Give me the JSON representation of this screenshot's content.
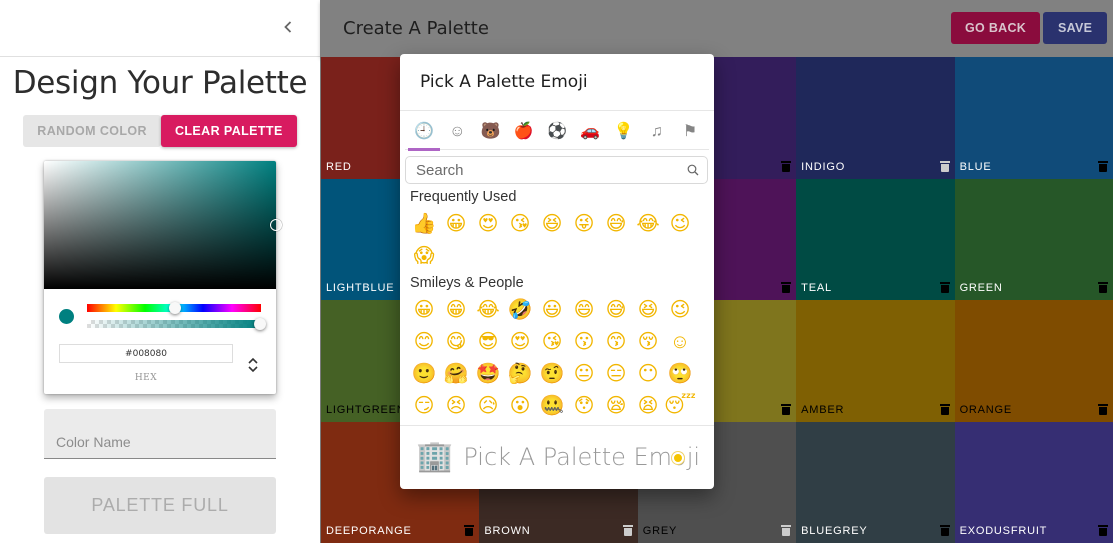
{
  "sidebar": {
    "title": "Design Your Palette",
    "random_color_label": "Random Color",
    "clear_palette_label": "Clear Palette",
    "picker": {
      "hex_value": "#008080",
      "mode_label": "HEX"
    },
    "color_name_placeholder": "Color Name",
    "palette_full_label": "Palette Full"
  },
  "appbar": {
    "title": "Create A Palette",
    "go_back_label": "GO BACK",
    "save_label": "SAVE"
  },
  "palette": [
    {
      "name": "red",
      "color": "#F44336",
      "trash": true
    },
    {
      "name": "",
      "color": "#E91E63",
      "trash": true
    },
    {
      "name": "",
      "color": "#673AB7",
      "trash": true
    },
    {
      "name": "indigo",
      "color": "#3F51B5",
      "trash": true
    },
    {
      "name": "blue",
      "color": "#2196F3",
      "trash": true
    },
    {
      "name": "lightblue",
      "color": "#03A9F4",
      "trash": true
    },
    {
      "name": "",
      "color": "#00BCD4",
      "trash": true
    },
    {
      "name": "",
      "color": "#9C27B0",
      "trash": true
    },
    {
      "name": "teal",
      "color": "#009688",
      "trash": true
    },
    {
      "name": "green",
      "color": "#4CAF50",
      "trash": true
    },
    {
      "name": "lightgreen",
      "color": "#8BC34A",
      "trash": true
    },
    {
      "name": "",
      "color": "#CDDC39",
      "trash": true
    },
    {
      "name": "",
      "color": "#FFEB3B",
      "trash": true
    },
    {
      "name": "amber",
      "color": "#FFC107",
      "trash": true
    },
    {
      "name": "orange",
      "color": "#FF9800",
      "trash": true
    },
    {
      "name": "deeporange",
      "color": "#FF5722",
      "trash": true
    },
    {
      "name": "brown",
      "color": "#795548",
      "trash": true
    },
    {
      "name": "grey",
      "color": "#9E9E9E",
      "trash": true
    },
    {
      "name": "bluegrey",
      "color": "#607D8B",
      "trash": true
    },
    {
      "name": "exodusfruit",
      "color": "#6C5CE7",
      "trash": true
    }
  ],
  "emoji_picker": {
    "title": "Pick A Palette Emoji",
    "categories": [
      {
        "icon": "clock-icon",
        "glyph": "🕘"
      },
      {
        "icon": "smiley-icon",
        "glyph": "☺"
      },
      {
        "icon": "animal-icon",
        "glyph": "🐻"
      },
      {
        "icon": "food-icon",
        "glyph": "🍎"
      },
      {
        "icon": "activity-icon",
        "glyph": "⚽"
      },
      {
        "icon": "travel-icon",
        "glyph": "🚗"
      },
      {
        "icon": "objects-icon",
        "glyph": "💡"
      },
      {
        "icon": "symbols-icon",
        "glyph": "♫"
      },
      {
        "icon": "flags-icon",
        "glyph": "⚑"
      }
    ],
    "search_placeholder": "Search",
    "sections": [
      {
        "label": "Frequently Used",
        "emojis": [
          "👍",
          "😀",
          "😍",
          "😘",
          "😆",
          "😜",
          "😅",
          "😂",
          "😉",
          "😱"
        ]
      },
      {
        "label": "Smileys & People",
        "emojis": [
          "😀",
          "😁",
          "😂",
          "🤣",
          "😃",
          "😄",
          "😅",
          "😆",
          "😉",
          "😊",
          "😋",
          "😎",
          "😍",
          "😘",
          "😗",
          "😙",
          "😚",
          "☺",
          "🙂",
          "🤗",
          "🤩",
          "🤔",
          "🤨",
          "😐",
          "😑",
          "😶",
          "🙄",
          "😏",
          "😣",
          "😥",
          "😮",
          "🤐",
          "😯",
          "😪",
          "😫",
          "😴"
        ]
      }
    ],
    "preview_emoji": "🏢",
    "preview_label": "Pick A Palette Emoji"
  },
  "colors": {
    "clear_palette": "#d81b60",
    "go_back": "#d81b60",
    "save": "#3f51b5",
    "picker_color": "#008080"
  }
}
